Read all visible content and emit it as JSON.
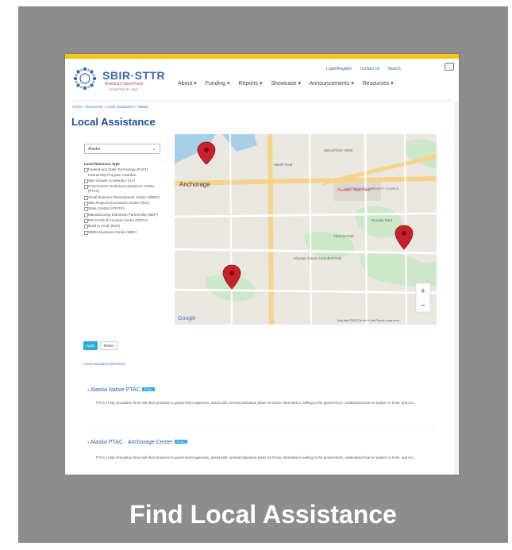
{
  "header": {
    "brand": "SBIR·STTR",
    "brand_sub": "America's Seed Fund",
    "brand_sub2": "POWERED BY SBA",
    "top_links": [
      "Login/Register",
      "Contact Us",
      "Search"
    ],
    "nav": [
      "About ▾",
      "Funding ▾",
      "Reports ▾",
      "Showcase ▾",
      "Announcements ▾",
      "Resources ▾"
    ]
  },
  "breadcrumb": "Home » Resources » Local Assistance » Alaska",
  "page_title": "Local Assistance",
  "filters": {
    "state_selected": "Alaska",
    "type_header": "Local Resource Type",
    "options": [
      "Federal and State Technology (FAST) Partnership Program Awardee",
      "SBA Growth Accelerator (GA)",
      "Procurement Technical Assistance Center (PTAC)",
      "Small Business Development Center (SBDC)",
      "SBA Regional Innovation Cluster (RIC)",
      "State Contact (STATE)",
      "Manufacturing Extension Partnership (MEP)",
      "NIH Proof-of-Concept Center (POCC)",
      "Build to Scale (B2S)",
      "MBDA Business Center (MBC)"
    ],
    "apply_label": "Apply",
    "reset_label": "Reset"
  },
  "directory_link": "Local Assistance Directory",
  "map": {
    "labels": [
      "Anchorage",
      "Russian Jack Park",
      "Tikishla Park",
      "Chester Creek Greenbelt Park",
      "Nunaka Park",
      "MOUNTAIN VIEW",
      "NORTHEAST COMMUNITY COUNCIL",
      "Merrill Field"
    ],
    "zoom_in": "+",
    "zoom_out": "−",
    "google_logo": "Google",
    "footer_text": "Map data ©2021   Terms of Use   Report a map error"
  },
  "results": [
    {
      "title": "› Alaska Native PTAC",
      "tag": "PTAC",
      "desc": "PTACs help innovative firms sell their products to government agencies, assist with commercialization plans for those interested in selling to the government, understand how to register in SAM, and mo..."
    },
    {
      "title": "› Alaska PTAC - Anchorage Center",
      "tag": "PTAC",
      "desc": "PTACs help innovative firms sell their products to government agencies, assist with commercialization plans for those interested in selling to the government, understand how to register in SAM, and mo..."
    }
  ],
  "caption": "Find Local Assistance",
  "colors": {
    "accent": "#29a9e0",
    "brand_blue": "#1d4c96",
    "top_bar": "#f3c417",
    "frame": "#8d8d8d",
    "marker": "#c8212b"
  }
}
